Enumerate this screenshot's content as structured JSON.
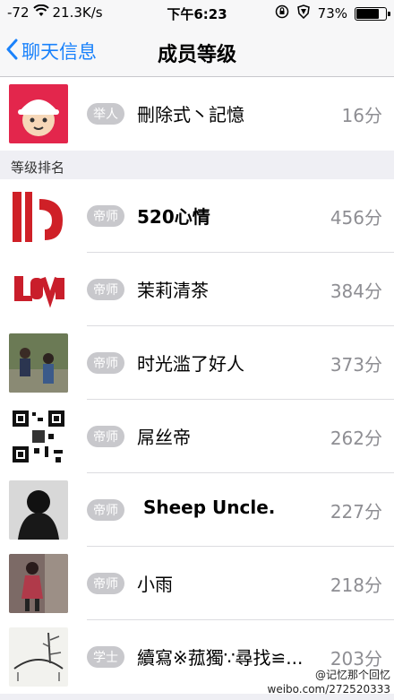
{
  "status_bar": {
    "signal": "-72",
    "speed": "21.3K/s",
    "time": "下午6:23",
    "battery": "73%",
    "battery_level": 0.73
  },
  "nav": {
    "back_label": "聊天信息",
    "title": "成员等级"
  },
  "self_member": {
    "badge": "举人",
    "name": "刪除式丶記憶",
    "score": "16分"
  },
  "section_title": "等级排名",
  "members": [
    {
      "badge": "帝师",
      "name": "520心情",
      "score": "456分"
    },
    {
      "badge": "帝师",
      "name": "茉莉清茶",
      "score": "384分"
    },
    {
      "badge": "帝师",
      "name": "时光滥了好人",
      "score": "373分"
    },
    {
      "badge": "帝师",
      "name": "屌丝帝",
      "score": "262分"
    },
    {
      "badge": "帝师",
      "name": " Sheep Uncle.",
      "score": "227分"
    },
    {
      "badge": "帝师",
      "name": "小雨",
      "score": "218分"
    },
    {
      "badge": "学士",
      "name": "續寫※菰獨∵尋找≌...",
      "score": "203分"
    }
  ],
  "watermark": {
    "line1": "@记忆那个回忆",
    "line2": "weibo.com/272520333"
  }
}
